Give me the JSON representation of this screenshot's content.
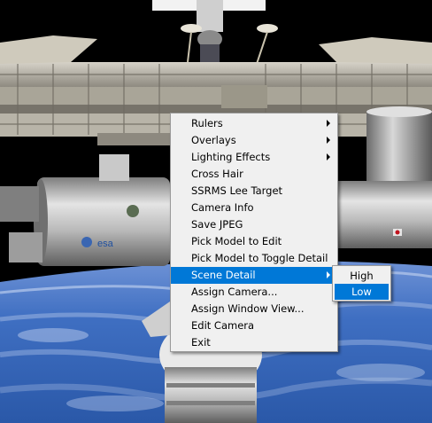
{
  "context_menu": {
    "items": [
      {
        "label": "Rulers",
        "submenu": true,
        "selected": false
      },
      {
        "label": "Overlays",
        "submenu": true,
        "selected": false
      },
      {
        "label": "Lighting Effects",
        "submenu": true,
        "selected": false
      },
      {
        "label": "Cross Hair",
        "submenu": false,
        "selected": false
      },
      {
        "label": "SSRMS Lee Target",
        "submenu": false,
        "selected": false
      },
      {
        "label": "Camera Info",
        "submenu": false,
        "selected": false
      },
      {
        "label": "Save JPEG",
        "submenu": false,
        "selected": false
      },
      {
        "label": "Pick Model to Edit",
        "submenu": false,
        "selected": false
      },
      {
        "label": "Pick Model to Toggle Detail",
        "submenu": false,
        "selected": false
      },
      {
        "label": "Scene Detail",
        "submenu": true,
        "selected": true
      },
      {
        "label": "Assign Camera...",
        "submenu": false,
        "selected": false
      },
      {
        "label": "Assign Window View...",
        "submenu": false,
        "selected": false
      },
      {
        "label": "Edit Camera",
        "submenu": false,
        "selected": false
      },
      {
        "label": "Exit",
        "submenu": false,
        "selected": false
      }
    ]
  },
  "scene_detail_submenu": {
    "items": [
      {
        "label": "High",
        "selected": false
      },
      {
        "label": "Low",
        "selected": true
      }
    ]
  },
  "scene": {
    "module_logo_text": "esa",
    "colors": {
      "space": "#000000",
      "earth": "#2f62b5",
      "highlight": "#0078d7",
      "menu_bg": "#f0f0f0"
    }
  }
}
